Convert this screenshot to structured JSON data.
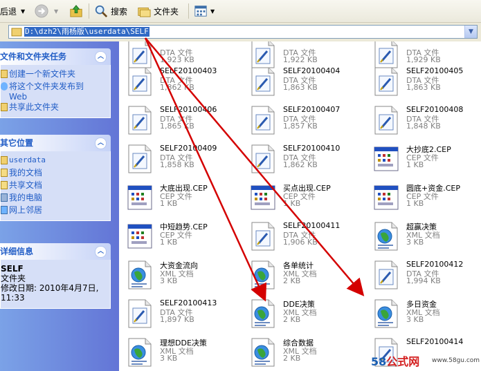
{
  "toolbar": {
    "back_label": "后退",
    "search_label": "搜索",
    "folders_label": "文件夹"
  },
  "address": {
    "path": "D:\\dzh2\\雨杨版\\userdata\\SELF"
  },
  "tasks_panel": {
    "title": "文件和文件夹任务",
    "items": [
      "创建一个新文件夹",
      "将这个文件夹发布到",
      "Web",
      "共享此文件夹"
    ]
  },
  "places_panel": {
    "title": "其它位置",
    "items": [
      "userdata",
      "我的文档",
      "共享文档",
      "我的电脑",
      "网上邻居"
    ]
  },
  "details_panel": {
    "title": "详细信息",
    "name": "SELF",
    "type": "文件夹",
    "modified": "修改日期: 2010年4月7日,",
    "time": "11:33"
  },
  "files": [
    {
      "name": "",
      "type": "DTA 文件",
      "size": "1,923 KB",
      "icon": "dta-file-icon"
    },
    {
      "name": "",
      "type": "DTA 文件",
      "size": "1,922 KB",
      "icon": "dta-file-icon"
    },
    {
      "name": "",
      "type": "DTA 文件",
      "size": "1,929 KB",
      "icon": "dta-file-icon"
    },
    {
      "name": "SELF20100403",
      "type": "DTA 文件",
      "size": "1,862 KB",
      "icon": "dta-file-icon"
    },
    {
      "name": "SELF20100404",
      "type": "DTA 文件",
      "size": "1,863 KB",
      "icon": "dta-file-icon"
    },
    {
      "name": "SELF20100405",
      "type": "DTA 文件",
      "size": "1,863 KB",
      "icon": "dta-file-icon"
    },
    {
      "name": "SELF20100406",
      "type": "DTA 文件",
      "size": "1,865 KB",
      "icon": "dta-file-icon"
    },
    {
      "name": "SELF20100407",
      "type": "DTA 文件",
      "size": "1,857 KB",
      "icon": "dta-file-icon"
    },
    {
      "name": "SELF20100408",
      "type": "DTA 文件",
      "size": "1,848 KB",
      "icon": "dta-file-icon"
    },
    {
      "name": "SELF20100409",
      "type": "DTA 文件",
      "size": "1,858 KB",
      "icon": "dta-file-icon"
    },
    {
      "name": "SELF20100410",
      "type": "DTA 文件",
      "size": "1,862 KB",
      "icon": "dta-file-icon"
    },
    {
      "name": "大抄底2.CEP",
      "type": "CEP 文件",
      "size": "1 KB",
      "icon": "cep-file-icon"
    },
    {
      "name": "大底出现.CEP",
      "type": "CEP 文件",
      "size": "1 KB",
      "icon": "cep-file-icon"
    },
    {
      "name": "买点出现.CEP",
      "type": "CEP 文件",
      "size": "1 KB",
      "icon": "cep-file-icon"
    },
    {
      "name": "圆底+资金.CEP",
      "type": "CEP 文件",
      "size": "1 KB",
      "icon": "cep-file-icon"
    },
    {
      "name": "中短趋势.CEP",
      "type": "CEP 文件",
      "size": "1 KB",
      "icon": "cep-file-icon"
    },
    {
      "name": "SELF20100411",
      "type": "DTA 文件",
      "size": "1,906 KB",
      "icon": "dta-file-icon"
    },
    {
      "name": "超赢决策",
      "type": "XML 文档",
      "size": "3 KB",
      "icon": "xml-file-icon"
    },
    {
      "name": "大资金流向",
      "type": "XML 文档",
      "size": "3 KB",
      "icon": "xml-file-icon"
    },
    {
      "name": "各单统计",
      "type": "XML 文档",
      "size": "2 KB",
      "icon": "xml-file-icon"
    },
    {
      "name": "SELF20100412",
      "type": "DTA 文件",
      "size": "1,994 KB",
      "icon": "dta-file-icon"
    },
    {
      "name": "SELF20100413",
      "type": "DTA 文件",
      "size": "1,897 KB",
      "icon": "dta-file-icon"
    },
    {
      "name": "DDE决策",
      "type": "XML 文档",
      "size": "2 KB",
      "icon": "xml-file-icon"
    },
    {
      "name": "多日资金",
      "type": "XML 文档",
      "size": "3 KB",
      "icon": "xml-file-icon"
    },
    {
      "name": "理想DDE决策",
      "type": "XML 文档",
      "size": "3 KB",
      "icon": "xml-file-icon"
    },
    {
      "name": "综合数据",
      "type": "XML 文档",
      "size": "2 KB",
      "icon": "xml-file-icon"
    },
    {
      "name": "SELF20100414",
      "type": "",
      "size": "",
      "icon": "dta-file-icon"
    }
  ],
  "watermark": {
    "brand_num": "58",
    "brand_text": "公式网",
    "url": "www.58gu.com"
  },
  "colors": {
    "arrow": "#d40000",
    "panel_title": "#215dc6",
    "selection": "#316ac5"
  }
}
